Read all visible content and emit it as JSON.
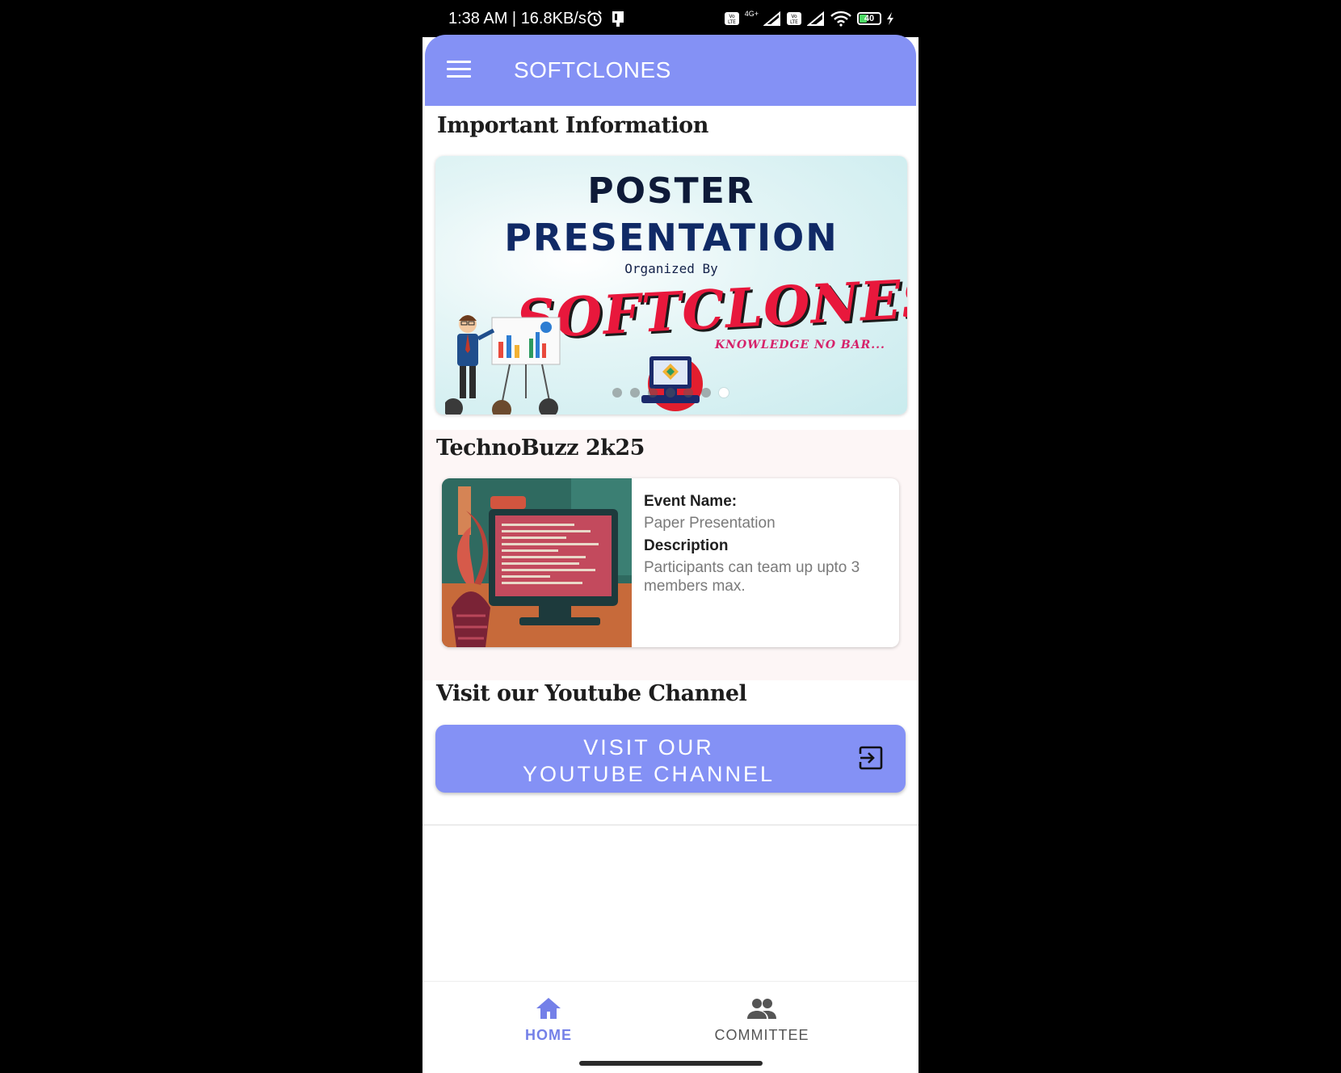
{
  "status_bar": {
    "time": "1:38 AM | 16.8KB/s",
    "battery_level": "40",
    "icons": [
      "alarm-icon",
      "sim-icon",
      "volte-icon",
      "signal-icon",
      "wifi-icon",
      "battery-icon",
      "charging-icon"
    ],
    "network_label": "4G+"
  },
  "app_bar": {
    "title": "SOFTCLONES",
    "menu_icon": "hamburger-menu-icon",
    "background": "#8491f5"
  },
  "important_info": {
    "heading": "Important Information",
    "carousel": {
      "slide": {
        "line1": "POSTER",
        "line2": "PRESENTATION",
        "line3": "Organized By",
        "brand": "SOFTCLONES",
        "tagline": "KNOWLEDGE NO BAR..."
      },
      "dot_count": 7,
      "active_dot": 7
    }
  },
  "technobuzz": {
    "heading": "TechnoBuzz 2k25",
    "event": {
      "name_label": "Event Name:",
      "name_value": "Paper Presentation",
      "desc_label": "Description",
      "desc_value": "Participants can team up upto 3 members max."
    }
  },
  "youtube": {
    "heading": "Visit our Youtube Channel",
    "button_line1": "VISIT OUR",
    "button_line2": "YOUTUBE CHANNEL",
    "button_icon": "exit-to-app-icon"
  },
  "bottom_nav": {
    "items": [
      {
        "label": "HOME",
        "icon": "home-icon",
        "active": true
      },
      {
        "label": "COMMITTEE",
        "icon": "people-icon",
        "active": false
      }
    ],
    "active_color": "#7480e8"
  }
}
